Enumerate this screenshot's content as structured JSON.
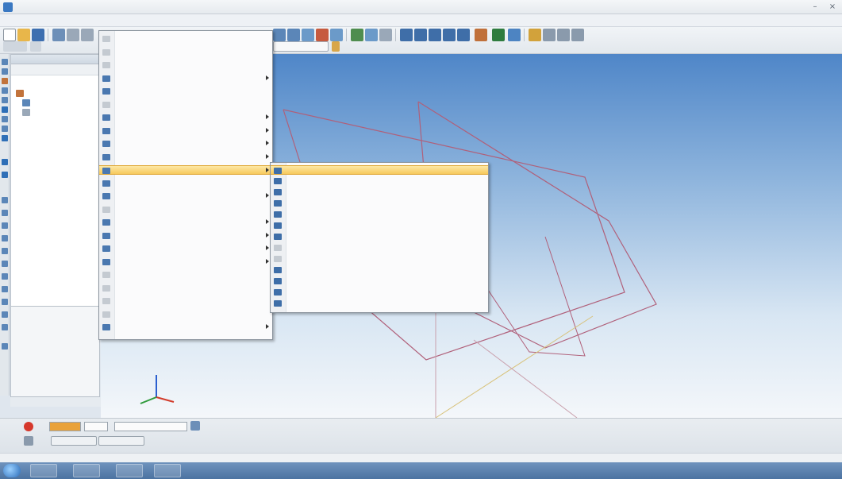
{
  "window": {
    "title": "",
    "minimize_glyph": "–",
    "close_glyph": "×"
  },
  "menubar": {
    "items": [
      "",
      "",
      "",
      "",
      "",
      "",
      "",
      "",
      ""
    ]
  },
  "tree": {
    "rows": [
      "",
      "",
      ""
    ]
  },
  "context_menu": {
    "items": [
      {
        "label": "",
        "submenu": false,
        "disabled": true
      },
      {
        "label": "",
        "submenu": false,
        "disabled": true
      },
      {
        "label": "",
        "submenu": false,
        "disabled": true
      },
      {
        "label": "",
        "submenu": true,
        "disabled": false
      },
      {
        "label": "",
        "submenu": false,
        "disabled": false
      },
      {
        "label": "",
        "submenu": false,
        "disabled": true
      },
      {
        "label": "",
        "submenu": true,
        "disabled": false
      },
      {
        "label": "",
        "submenu": true,
        "disabled": false
      },
      {
        "label": "",
        "submenu": true,
        "disabled": false
      },
      {
        "label": "",
        "submenu": true,
        "disabled": false
      },
      {
        "label": "",
        "submenu": true,
        "disabled": false,
        "highlighted": true
      },
      {
        "label": "",
        "submenu": false,
        "disabled": false
      },
      {
        "label": "",
        "submenu": true,
        "disabled": false
      },
      {
        "label": "",
        "submenu": false,
        "disabled": true
      },
      {
        "label": "",
        "submenu": true,
        "disabled": false
      },
      {
        "label": "",
        "submenu": true,
        "disabled": false
      },
      {
        "label": "",
        "submenu": true,
        "disabled": false
      },
      {
        "label": "",
        "submenu": true,
        "disabled": false
      },
      {
        "label": "",
        "submenu": false,
        "disabled": true
      },
      {
        "label": "",
        "submenu": false,
        "disabled": true
      },
      {
        "label": "",
        "submenu": false,
        "disabled": true
      },
      {
        "label": "",
        "submenu": false,
        "disabled": true
      },
      {
        "label": "",
        "submenu": true,
        "disabled": false
      }
    ]
  },
  "submenu": {
    "items": [
      {
        "label": "",
        "highlighted": true
      },
      {
        "label": ""
      },
      {
        "label": ""
      },
      {
        "label": ""
      },
      {
        "label": ""
      },
      {
        "label": ""
      },
      {
        "label": ""
      },
      {
        "label": "",
        "disabled": true
      },
      {
        "label": "",
        "disabled": true
      },
      {
        "label": ""
      },
      {
        "label": ""
      },
      {
        "label": ""
      },
      {
        "label": ""
      }
    ]
  },
  "property_panel": {
    "field_a": "",
    "field_b": "",
    "field_c": ""
  },
  "status": {
    "text": ""
  },
  "taskbar": {
    "tray_text": ""
  },
  "colors": {
    "accent": "#3a78c2",
    "menu_highlight": "#f7c95c",
    "viewport_top": "#4f86c8",
    "wireframe": "#b0607a",
    "axis_x": "#d23b2a",
    "axis_y": "#2f9a3a",
    "axis_z": "#2b5fcf"
  },
  "icons": {
    "start": "windows-orb-icon",
    "triad": "coordinate-axes-icon"
  }
}
